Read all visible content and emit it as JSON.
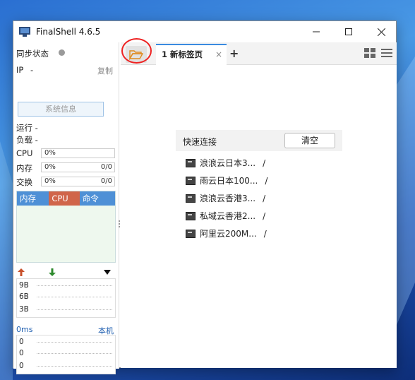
{
  "window": {
    "title": "FinalShell 4.6.5"
  },
  "sidebar": {
    "sync_label": "同步状态",
    "ip_label": "IP",
    "ip_value": "-",
    "copy_label": "复制",
    "sysinfo_label": "系统信息",
    "uptime_label": "运行 -",
    "load_label": "负载 -",
    "cpu": {
      "label": "CPU",
      "value": "0%"
    },
    "mem": {
      "label": "内存",
      "value": "0%",
      "right": "0/0"
    },
    "swap": {
      "label": "交换",
      "value": "0%",
      "right": "0/0"
    },
    "proc_headers": [
      "内存",
      "CPU",
      "命令"
    ],
    "net_labels": [
      "9B",
      "6B",
      "3B"
    ],
    "latency": {
      "label": "0ms",
      "right": "本机",
      "rows": [
        "0",
        "0",
        "0"
      ]
    }
  },
  "tabs": [
    {
      "label": "1 新标签页",
      "close": "×"
    }
  ],
  "tab_add": "+",
  "quick_connect": {
    "title": "快速连接",
    "clear_label": "清空",
    "items": [
      {
        "name": "浪浪云日本3...",
        "path": "/"
      },
      {
        "name": "雨云日本100...",
        "path": "/"
      },
      {
        "name": "浪浪云香港3...",
        "path": "/"
      },
      {
        "name": "私域云香港2...",
        "path": "/"
      },
      {
        "name": "阿里云200M...",
        "path": "/"
      }
    ]
  },
  "colors": {
    "mem_col": "#4e90d6",
    "cpu_col": "#d0654a",
    "cmd_col": "#4e90d6",
    "accent": "#3a8be0",
    "annotation": "#e22222"
  }
}
